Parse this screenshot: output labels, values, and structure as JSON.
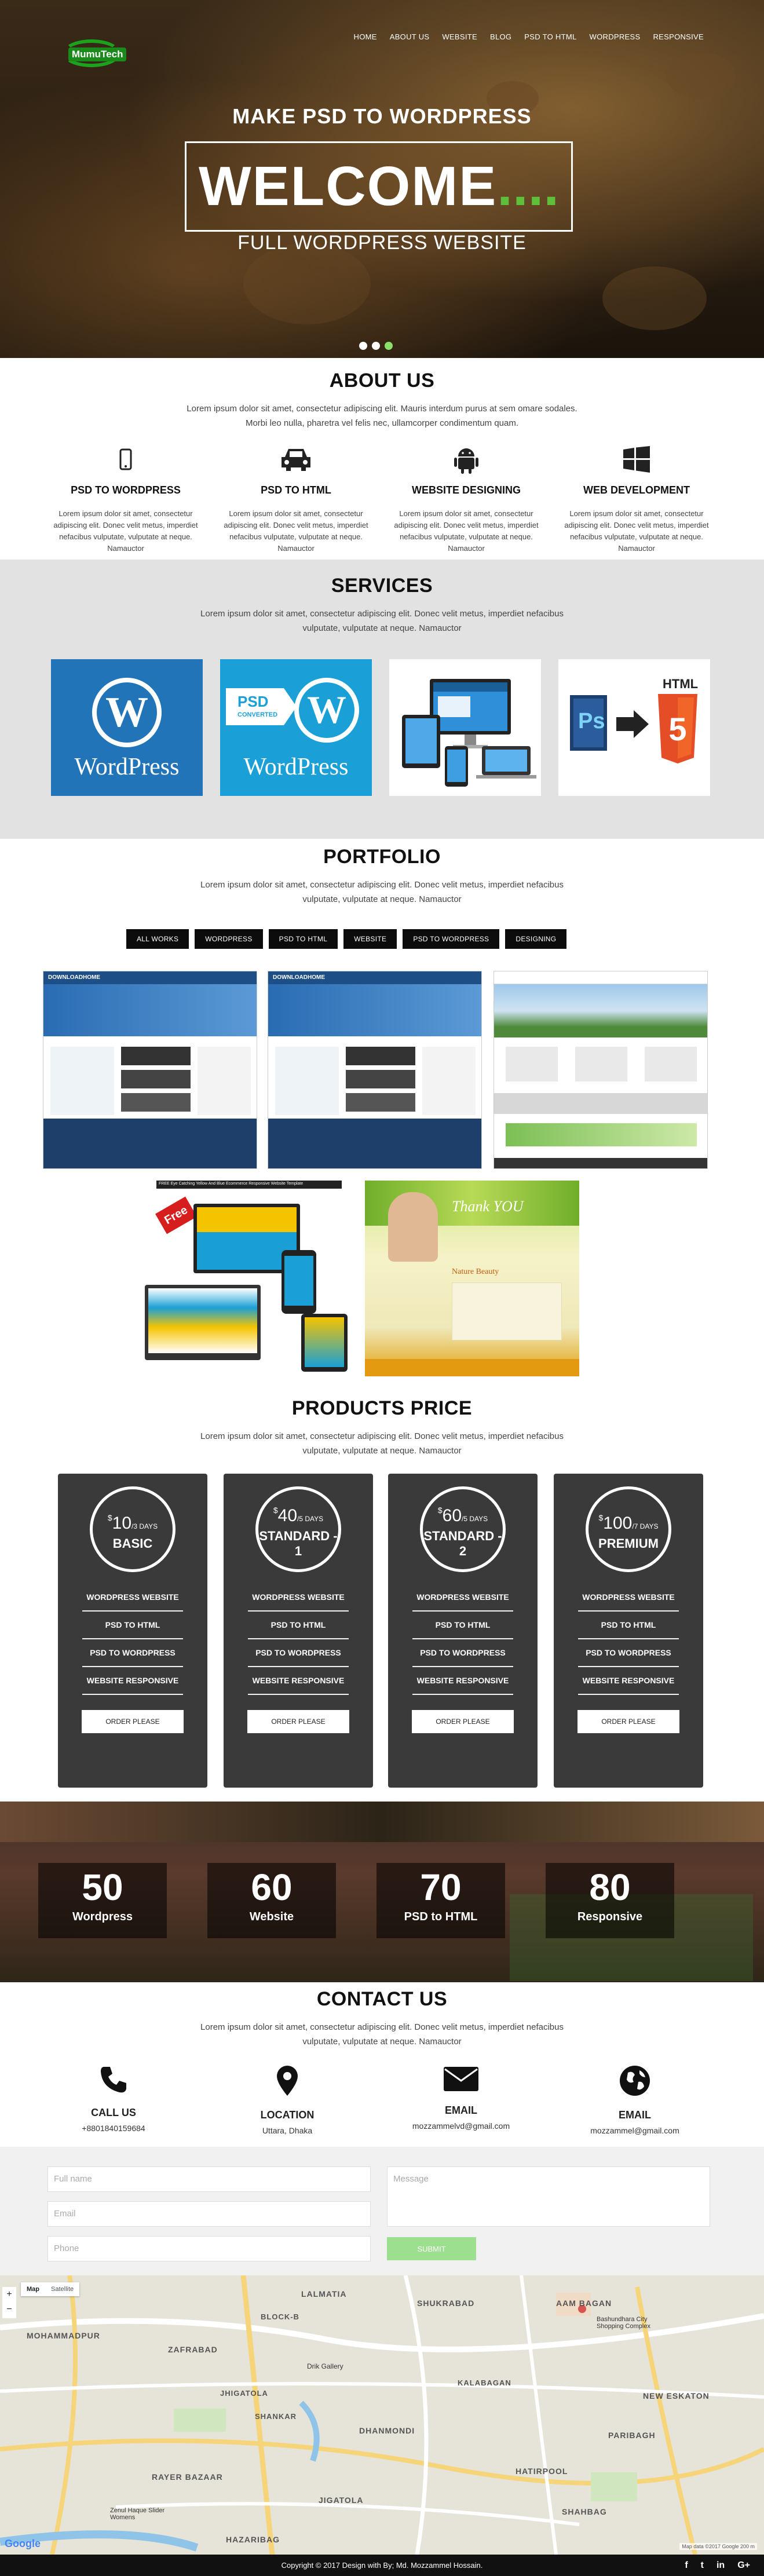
{
  "logo": "MumuTech",
  "nav": [
    "HOME",
    "ABOUT US",
    "WEBSITE",
    "BLOG",
    "PSD TO HTML",
    "WORDPRESS",
    "RESPONSIVE"
  ],
  "hero": {
    "subtitle": "MAKE PSD TO WORDPRESS",
    "welcome": "WELCOME",
    "dots": "....",
    "tagline": "FULL WORDPRESS WEBSITE"
  },
  "about": {
    "title": "ABOUT US",
    "lead": "Lorem ipsum dolor sit amet, consectetur adipiscing elit. Mauris interdum purus at sem omare sodales. Morbi leo nulla, pharetra vel felis nec, ullamcorper condimentum quam.",
    "features": [
      {
        "icon": "mobile-icon",
        "title": "PSD TO WORDPRESS",
        "text": "Lorem ipsum dolor sit amet, consectetur adipiscing elit. Donec velit metus, imperdiet nefacibus vulputate, vulputate at neque. Namauctor"
      },
      {
        "icon": "car-icon",
        "title": "PSD TO HTML",
        "text": "Lorem ipsum dolor sit amet, consectetur adipiscing elit. Donec velit metus, imperdiet nefacibus vulputate, vulputate at neque. Namauctor"
      },
      {
        "icon": "android-icon",
        "title": "WEBSITE DESIGNING",
        "text": "Lorem ipsum dolor sit amet, consectetur adipiscing elit. Donec velit metus, imperdiet nefacibus vulputate, vulputate at neque. Namauctor"
      },
      {
        "icon": "windows-icon",
        "title": "WEB DEVELOPMENT",
        "text": "Lorem ipsum dolor sit amet, consectetur adipiscing elit. Donec velit metus, imperdiet nefacibus vulputate, vulputate at neque. Namauctor"
      }
    ]
  },
  "services": {
    "title": "SERVICES",
    "lead": "Lorem ipsum dolor sit amet, consectetur adipiscing elit. Donec velit metus, imperdiet nefacibus vulputate, vulputate at neque. Namauctor",
    "tiles": [
      {
        "caption": "WordPress"
      },
      {
        "caption": "WordPress",
        "badge1": "PSD",
        "badge2": "CONVERTED"
      },
      {
        "caption": ""
      },
      {
        "caption": "HTML",
        "ps": "Ps",
        "five": "5"
      }
    ]
  },
  "portfolio": {
    "title": "PORTFOLIO",
    "lead": "Lorem ipsum dolor sit amet, consectetur adipiscing elit. Donec velit metus, imperdiet nefacibus vulputate, vulputate at neque. Namauctor",
    "filters": [
      "ALL WORKS",
      "WORDPRESS",
      "PSD TO HTML",
      "WEBSITE",
      "PSD TO WORDPRESS",
      "DESIGNING"
    ],
    "shot_label": "DOWNLOADHOME",
    "free_label": "Free",
    "free_title": "FREE Eye Catching Yellow And Blue Ecommerce Responsive Website Template",
    "nature_title": "Thank YOU",
    "nature_sub": "Nature Beauty"
  },
  "pricing": {
    "title": "PRODUCTS PRICE",
    "lead": "Lorem ipsum dolor sit amet, consectetur adipiscing elit. Donec velit metus, imperdiet nefacibus vulputate, vulputate at neque. Namauctor",
    "plans": [
      {
        "currency": "$",
        "amount": "10",
        "period": "/3 DAYS",
        "name": "BASIC"
      },
      {
        "currency": "$",
        "amount": "40",
        "period": "/5 DAYS",
        "name": "STANDARD - 1"
      },
      {
        "currency": "$",
        "amount": "60",
        "period": "/5 DAYS",
        "name": "STANDARD - 2"
      },
      {
        "currency": "$",
        "amount": "100",
        "period": "/7 DAYS",
        "name": "PREMIUM"
      }
    ],
    "features": [
      "WORDPRESS WEBSITE",
      "PSD TO HTML",
      "PSD TO WORDPRESS",
      "WEBSITE RESPONSIVE"
    ],
    "button": "ORDER PLEASE"
  },
  "counters": [
    {
      "value": "50",
      "label": "Wordpress"
    },
    {
      "value": "60",
      "label": "Website"
    },
    {
      "value": "70",
      "label": "PSD to HTML"
    },
    {
      "value": "80",
      "label": "Responsive"
    }
  ],
  "contact": {
    "title": "CONTACT US",
    "lead": "Lorem ipsum dolor sit amet, consectetur adipiscing elit. Donec velit metus, imperdiet nefacibus vulputate, vulputate at neque. Namauctor",
    "items": [
      {
        "icon": "phone-icon",
        "title": "CALL US",
        "value": "+8801840159684"
      },
      {
        "icon": "location-icon",
        "title": "LOCATION",
        "value": "Uttara, Dhaka"
      },
      {
        "icon": "email-envelope-icon",
        "title": "EMAIL",
        "value": "mozzammelvd@gmail.com"
      },
      {
        "icon": "globe-icon",
        "title": "EMAIL",
        "value": "mozzammel@gmail.com"
      }
    ]
  },
  "form": {
    "name_placeholder": "Full name",
    "email_placeholder": "Email",
    "phone_placeholder": "Phone",
    "message_placeholder": "Message",
    "submit": "SUBMIT"
  },
  "map": {
    "toggle_map": "Map",
    "toggle_sat": "Satellite",
    "labels": [
      "LALMATIA",
      "BLOCK-B",
      "SHUKRABAD",
      "AAM BAGAN",
      "Bashundhara City Shopping Complex",
      "MOHAMMADPUR",
      "ZAFRABAD",
      "Drik Gallery",
      "KALABAGAN",
      "NEW ESKATON",
      "JHIGATOLA",
      "SHANKAR",
      "DHANMONDI",
      "PARIBAGH",
      "RAYER BAZAAR",
      "HATIRPOOL",
      "Zenul Haque Slider Womens",
      "JIGATOLA",
      "SHAHBAG",
      "HAZARIBAG"
    ],
    "google": "Google",
    "attribution": "Map data ©2017 Google   200 m"
  },
  "footer": {
    "copyright": "Copyright © 2017 Design with By; Md. Mozzammel Hossain."
  },
  "social": [
    "f",
    "t",
    "in",
    "G+"
  ]
}
